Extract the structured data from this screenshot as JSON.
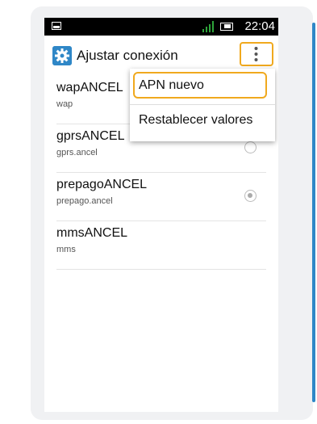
{
  "status_bar": {
    "time": "22:04",
    "icons": [
      "screenshot-icon",
      "signal-icon",
      "battery-icon"
    ]
  },
  "action_bar": {
    "title": "Ajustar conexión",
    "app_icon": "gear-icon",
    "overflow_icon": "overflow-menu-icon"
  },
  "apn_list": [
    {
      "name": "wapANCEL",
      "apn": "wap",
      "selected": false
    },
    {
      "name": "gprsANCEL",
      "apn": "gprs.ancel",
      "selected": false
    },
    {
      "name": "prepagoANCEL",
      "apn": "prepago.ancel",
      "selected": true
    },
    {
      "name": "mmsANCEL",
      "apn": "mms",
      "selected": false
    }
  ],
  "overflow_menu": {
    "items": [
      "APN nuevo",
      "Restablecer valores"
    ]
  },
  "colors": {
    "highlight": "#f0a91e",
    "accent": "#2f87c7"
  }
}
